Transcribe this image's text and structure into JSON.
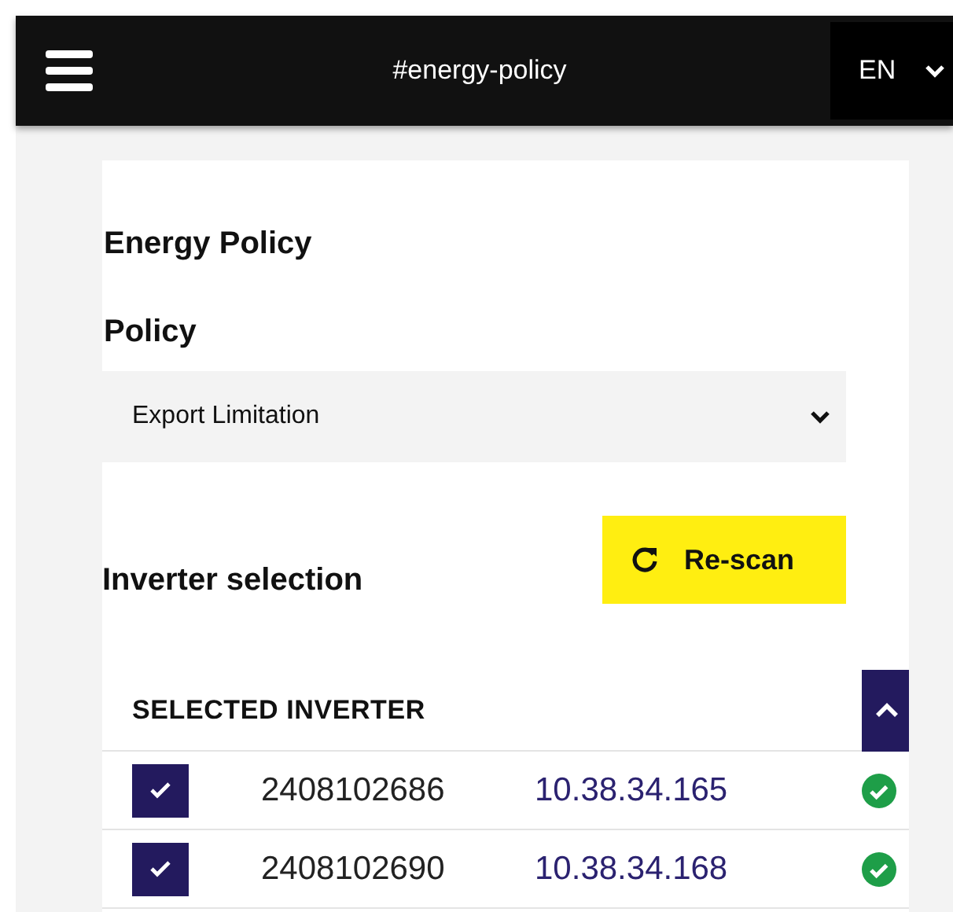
{
  "header": {
    "title": "#energy-policy",
    "language": "EN"
  },
  "card": {
    "title": "Energy Policy",
    "policy_label": "Policy",
    "policy_value": "Export Limitation",
    "rescan_button": "Re-scan",
    "section_title": "Inverter selection",
    "table": {
      "heading": "SELECTED INVERTER",
      "expanded": true,
      "rows": [
        {
          "checked": true,
          "serial": "2408102686",
          "ip": "10.38.34.165",
          "online": true
        },
        {
          "checked": true,
          "serial": "2408102690",
          "ip": "10.38.34.168",
          "online": true
        }
      ]
    }
  }
}
